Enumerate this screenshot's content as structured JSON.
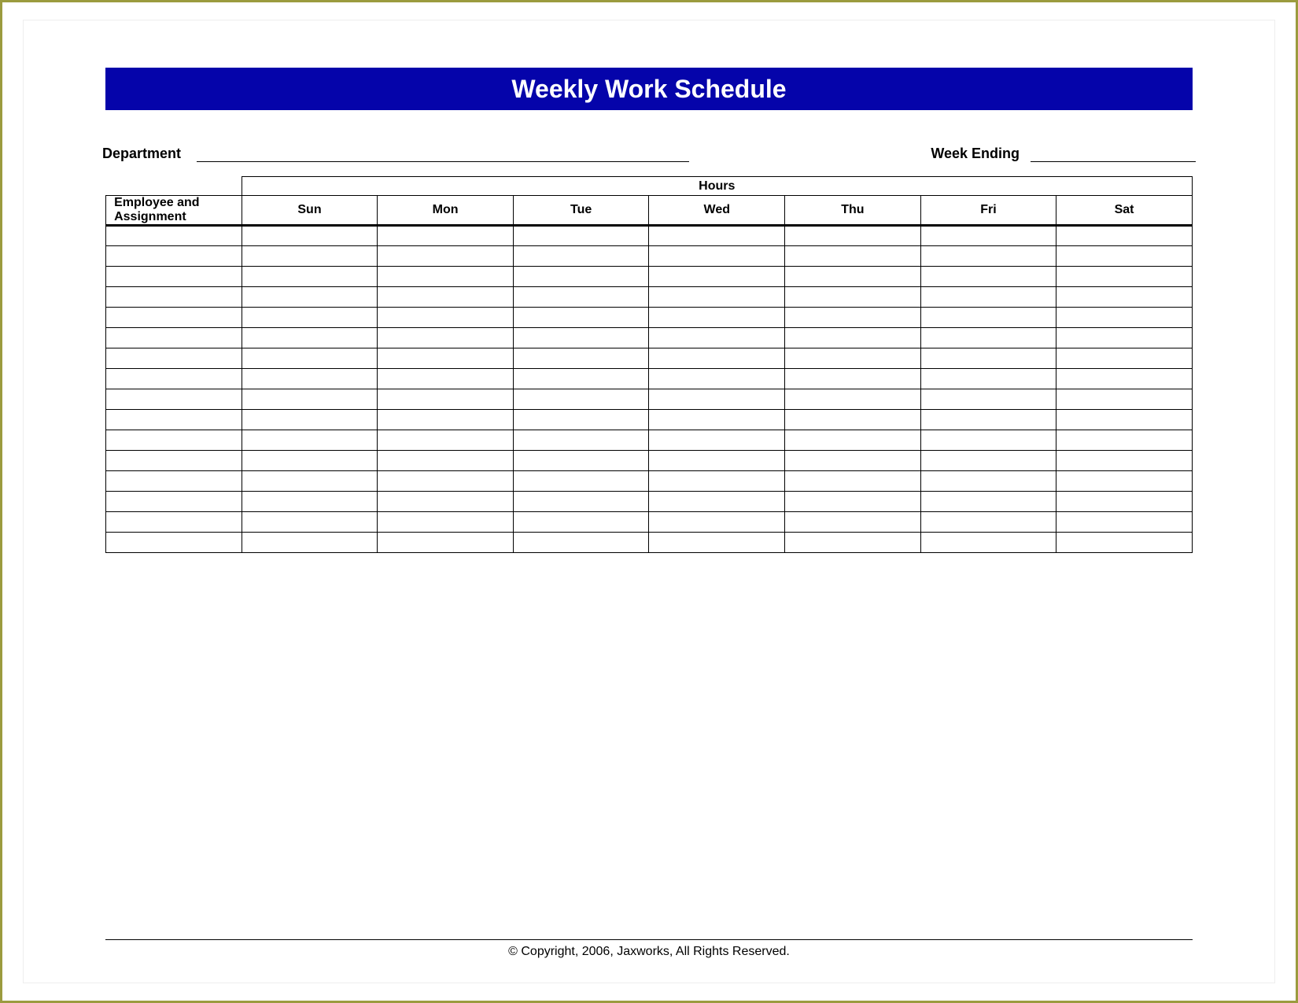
{
  "title": "Weekly Work Schedule",
  "meta": {
    "department_label": "Department",
    "week_ending_label": "Week Ending"
  },
  "table": {
    "employee_header": "Employee and Assignment",
    "hours_group_header": "Hours",
    "days": [
      "Sun",
      "Mon",
      "Tue",
      "Wed",
      "Thu",
      "Fri",
      "Sat"
    ],
    "rows": [
      {
        "employee": "",
        "hours": [
          "",
          "",
          "",
          "",
          "",
          "",
          ""
        ]
      },
      {
        "employee": "",
        "hours": [
          "",
          "",
          "",
          "",
          "",
          "",
          ""
        ]
      },
      {
        "employee": "",
        "hours": [
          "",
          "",
          "",
          "",
          "",
          "",
          ""
        ]
      },
      {
        "employee": "",
        "hours": [
          "",
          "",
          "",
          "",
          "",
          "",
          ""
        ]
      },
      {
        "employee": "",
        "hours": [
          "",
          "",
          "",
          "",
          "",
          "",
          ""
        ]
      },
      {
        "employee": "",
        "hours": [
          "",
          "",
          "",
          "",
          "",
          "",
          ""
        ]
      },
      {
        "employee": "",
        "hours": [
          "",
          "",
          "",
          "",
          "",
          "",
          ""
        ]
      },
      {
        "employee": "",
        "hours": [
          "",
          "",
          "",
          "",
          "",
          "",
          ""
        ]
      },
      {
        "employee": "",
        "hours": [
          "",
          "",
          "",
          "",
          "",
          "",
          ""
        ]
      },
      {
        "employee": "",
        "hours": [
          "",
          "",
          "",
          "",
          "",
          "",
          ""
        ]
      },
      {
        "employee": "",
        "hours": [
          "",
          "",
          "",
          "",
          "",
          "",
          ""
        ]
      },
      {
        "employee": "",
        "hours": [
          "",
          "",
          "",
          "",
          "",
          "",
          ""
        ]
      },
      {
        "employee": "",
        "hours": [
          "",
          "",
          "",
          "",
          "",
          "",
          ""
        ]
      },
      {
        "employee": "",
        "hours": [
          "",
          "",
          "",
          "",
          "",
          "",
          ""
        ]
      },
      {
        "employee": "",
        "hours": [
          "",
          "",
          "",
          "",
          "",
          "",
          ""
        ]
      },
      {
        "employee": "",
        "hours": [
          "",
          "",
          "",
          "",
          "",
          "",
          ""
        ]
      }
    ]
  },
  "copyright": "© Copyright, 2006, Jaxworks, All Rights Reserved."
}
